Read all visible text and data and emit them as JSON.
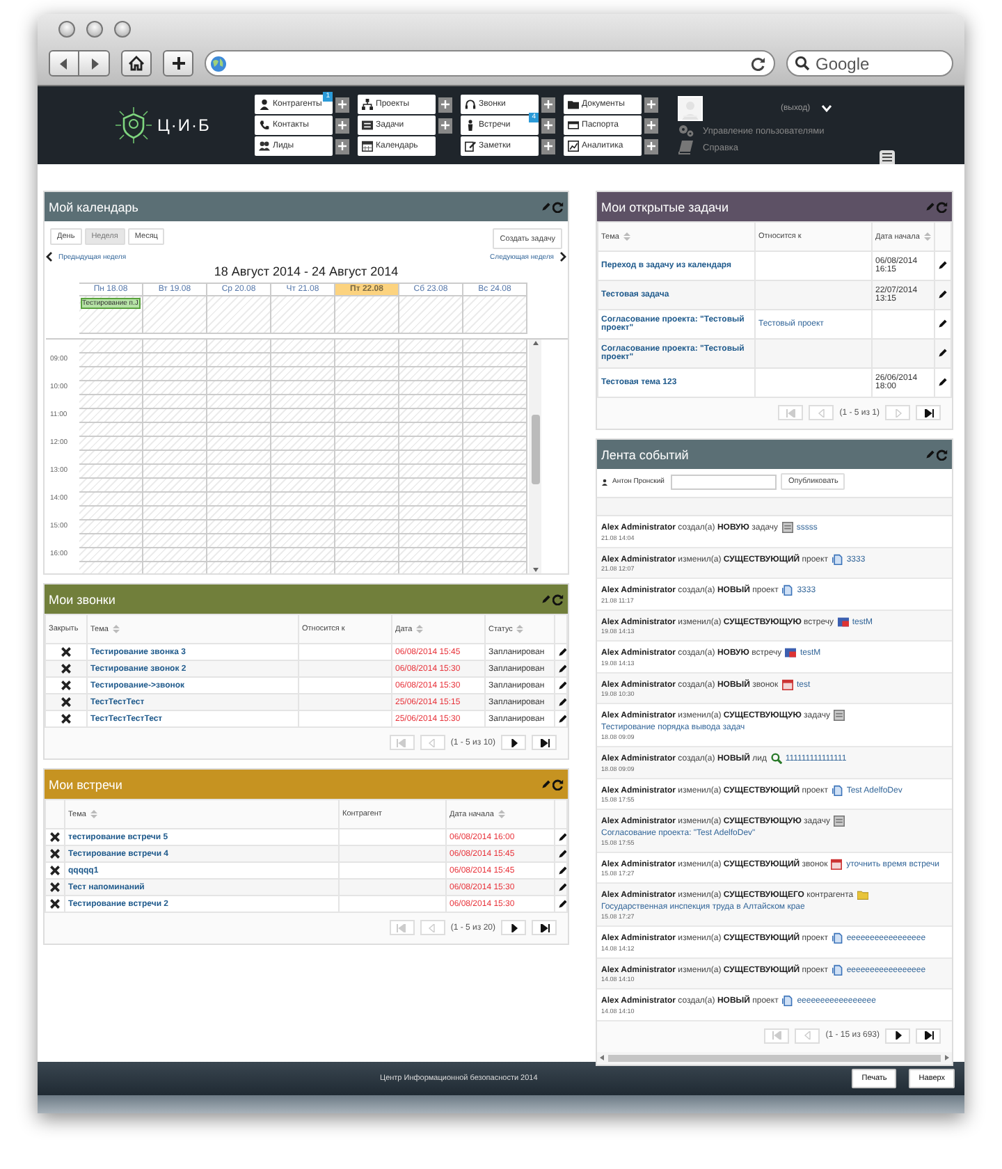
{
  "browser": {
    "search_placeholder": "Google"
  },
  "header": {
    "logo_text": "Ц·И·Б",
    "menu_groups": [
      [
        {
          "label": "Контрагенты",
          "badge": "1",
          "has_add": true
        },
        {
          "label": "Контакты",
          "has_add": true
        },
        {
          "label": "Лиды",
          "has_add": true
        }
      ],
      [
        {
          "label": "Проекты",
          "has_add": true
        },
        {
          "label": "Задачи",
          "has_add": true
        },
        {
          "label": "Календарь",
          "has_add": false
        }
      ],
      [
        {
          "label": "Звонки",
          "has_add": true
        },
        {
          "label": "Встречи",
          "badge": "4",
          "has_add": true
        },
        {
          "label": "Заметки",
          "has_add": true
        }
      ],
      [
        {
          "label": "Документы",
          "has_add": true
        },
        {
          "label": "Паспорта",
          "has_add": true
        },
        {
          "label": "Аналитика",
          "has_add": true
        }
      ]
    ],
    "logout": "(выход)",
    "links": [
      {
        "label": "Управление пользователями"
      },
      {
        "label": "Справка"
      }
    ]
  },
  "calendar": {
    "title": "Мой календарь",
    "views": [
      {
        "label": "День",
        "selected": false
      },
      {
        "label": "Неделя",
        "selected": true
      },
      {
        "label": "Месяц",
        "selected": false
      }
    ],
    "create_button": "Создать задачу",
    "prev_link": "Предыдущая неделя",
    "next_link": "Следующая неделя",
    "range": "18 Август 2014 - 24 Август 2014",
    "days": [
      {
        "label": "Пн 18.08",
        "selected": false,
        "event": "Тестирование п.J"
      },
      {
        "label": "Вт 19.08",
        "selected": false
      },
      {
        "label": "Ср 20.08",
        "selected": false
      },
      {
        "label": "Чт 21.08",
        "selected": false
      },
      {
        "label": "Пт 22.08",
        "selected": true
      },
      {
        "label": "Сб 23.08",
        "selected": false
      },
      {
        "label": "Вс 24.08",
        "selected": false
      }
    ],
    "hours": [
      "09:00",
      "10:00",
      "11:00",
      "12:00",
      "13:00",
      "14:00",
      "15:00",
      "16:00"
    ]
  },
  "calls": {
    "title": "Мои звонки",
    "columns": [
      {
        "label": "Закрыть",
        "sortable": false
      },
      {
        "label": "Тема",
        "sortable": true
      },
      {
        "label": "Относится к",
        "sortable": false
      },
      {
        "label": "Дата",
        "sortable": true
      },
      {
        "label": "Статус",
        "sortable": true
      }
    ],
    "rows": [
      {
        "subject": "Тестирование звонка 3",
        "date": "06/08/2014 15:45",
        "status": "Запланирован"
      },
      {
        "subject": "Тестирование звонок 2",
        "date": "06/08/2014 15:30",
        "status": "Запланирован"
      },
      {
        "subject": "Тестирование->звонок",
        "date": "06/08/2014 15:30",
        "status": "Запланирован"
      },
      {
        "subject": "ТестТестТест",
        "date": "25/06/2014 15:15",
        "status": "Запланирован"
      },
      {
        "subject": "ТестТестТестТест",
        "date": "25/06/2014 15:30",
        "status": "Запланирован"
      }
    ],
    "pager": {
      "text": "(1 - 5 из 10)",
      "buttons": [
        {
          "kind": "first",
          "disabled": true
        },
        {
          "kind": "prev",
          "disabled": true
        },
        {
          "kind": "next",
          "disabled": false
        },
        {
          "kind": "last",
          "disabled": false
        }
      ]
    }
  },
  "meetings": {
    "title": "Мои встречи",
    "columns": [
      {
        "label": "Тема",
        "sortable": true
      },
      {
        "label": "Контрагент",
        "sortable": false
      },
      {
        "label": "Дата начала",
        "sortable": true
      }
    ],
    "rows": [
      {
        "subject": "тестирование встречи 5",
        "date": "06/08/2014 16:00"
      },
      {
        "subject": "Тестирование встречи 4",
        "date": "06/08/2014 15:45"
      },
      {
        "subject": "qqqqq1",
        "date": "06/08/2014 15:45"
      },
      {
        "subject": "Тест напоминаний",
        "date": "06/08/2014 15:30"
      },
      {
        "subject": "Тестирование встречи 2",
        "date": "06/08/2014 15:30"
      }
    ],
    "pager": {
      "text": "(1 - 5 из 20)",
      "buttons": [
        {
          "kind": "first",
          "disabled": true
        },
        {
          "kind": "prev",
          "disabled": true
        },
        {
          "kind": "next",
          "disabled": false
        },
        {
          "kind": "last",
          "disabled": false
        }
      ]
    }
  },
  "tasks": {
    "title": "Мои открытые задачи",
    "columns": [
      {
        "label": "Тема",
        "sortable": true
      },
      {
        "label": "Относится к",
        "sortable": false
      },
      {
        "label": "Дата начала",
        "sortable": true
      }
    ],
    "rows": [
      {
        "subject": "Переход в задачу из календаря",
        "date": "06/08/2014 16:15"
      },
      {
        "subject": "Тестовая задача",
        "date": "22/07/2014 13:15"
      },
      {
        "subject": "Согласование проекта: \"Тестовый проект\"",
        "related": "Тестовый проект"
      },
      {
        "subject": "Согласование проекта: \"Тестовый проект\""
      },
      {
        "subject": "Тестовая тема 123",
        "date": "26/06/2014 18:00"
      }
    ],
    "pager": {
      "text": "(1 - 5 из 1)",
      "buttons": [
        {
          "kind": "first",
          "disabled": true
        },
        {
          "kind": "prev",
          "disabled": true
        },
        {
          "kind": "next",
          "disabled": true
        },
        {
          "kind": "last",
          "disabled": false
        }
      ]
    }
  },
  "feed": {
    "title": "Лента событий",
    "author": "Антон Пронский",
    "publish_button": "Опубликовать",
    "items": [
      {
        "text": "**Alex Administrator** создал(а) **НОВУЮ** задачу",
        "kind": "task",
        "link": "sssss",
        "time": "21.08 14:04"
      },
      {
        "text": "**Alex Administrator** изменил(а) **СУЩЕСТВУЮЩИЙ** проект",
        "kind": "project",
        "link": "3333",
        "time": "21.08 12:07"
      },
      {
        "text": "**Alex Administrator** создал(а) **НОВЫЙ** проект",
        "kind": "project",
        "link": "3333",
        "time": "21.08 11:17"
      },
      {
        "text": "**Alex Administrator** изменил(а) **СУЩЕСТВУЮЩУЮ** встречу",
        "kind": "meeting",
        "link": "testM",
        "time": "19.08 14:13"
      },
      {
        "text": "**Alex Administrator** создал(а) **НОВУЮ** встречу",
        "kind": "meeting",
        "link": "testM",
        "time": "19.08 14:13"
      },
      {
        "text": "**Alex Administrator** создал(а) **НОВЫЙ** звонок",
        "kind": "call",
        "link": "test",
        "time": "19.08 10:30"
      },
      {
        "text": "**Alex Administrator** изменил(а) **СУЩЕСТВУЮЩУЮ** задачу",
        "kind": "task",
        "link": "Тестирование порядка вывода задач",
        "time": "18.08 09:09"
      },
      {
        "text": "**Alex Administrator** создал(а) **НОВЫЙ** лид",
        "kind": "lead",
        "link": "111111111111111",
        "time": "18.08 09:09"
      },
      {
        "text": "**Alex Administrator** изменил(а) **СУЩЕСТВУЮЩИЙ** проект",
        "kind": "project",
        "link": "Test AdelfoDev",
        "time": "15.08 17:55"
      },
      {
        "text": "**Alex Administrator** изменил(а) **СУЩЕСТВУЮЩУЮ** задачу",
        "kind": "task",
        "link": "Согласование проекта: \"Test AdelfoDev\"",
        "time": "15.08 17:55"
      },
      {
        "text": "**Alex Administrator** изменил(а) **СУЩЕСТВУЮЩИЙ** звонок",
        "kind": "call",
        "link": "уточнить время встречи",
        "time": "15.08 17:27"
      },
      {
        "text": "**Alex Administrator** изменил(а) **СУЩЕСТВУЮЩЕГО** контрагента",
        "kind": "account",
        "link": "Государственная инспекция труда в Алтайском крае",
        "time": "15.08 17:27"
      },
      {
        "text": "**Alex Administrator** изменил(а) **СУЩЕСТВУЮЩИЙ** проект",
        "kind": "project",
        "link": "eeeeeeeeeeeeeeeee",
        "time": "14.08 14:12"
      },
      {
        "text": "**Alex Administrator** изменил(а) **СУЩЕСТВУЮЩИЙ** проект",
        "kind": "project",
        "link": "eeeeeeeeeeeeeeeee",
        "time": "14.08 14:10"
      },
      {
        "text": "**Alex Administrator** создал(а) **НОВЫЙ** проект",
        "kind": "project",
        "link": "eeeeeeeeeeeeeeeee",
        "time": "14.08 14:10"
      }
    ],
    "pager": {
      "text": "(1 - 15 из 693)",
      "buttons": [
        {
          "kind": "first",
          "disabled": true
        },
        {
          "kind": "prev",
          "disabled": true
        },
        {
          "kind": "next",
          "disabled": false
        },
        {
          "kind": "last",
          "disabled": false
        }
      ]
    }
  },
  "footer": {
    "text": "Центр Информационной безопасности 2014",
    "buttons": [
      "Печать",
      "Наверх"
    ]
  }
}
